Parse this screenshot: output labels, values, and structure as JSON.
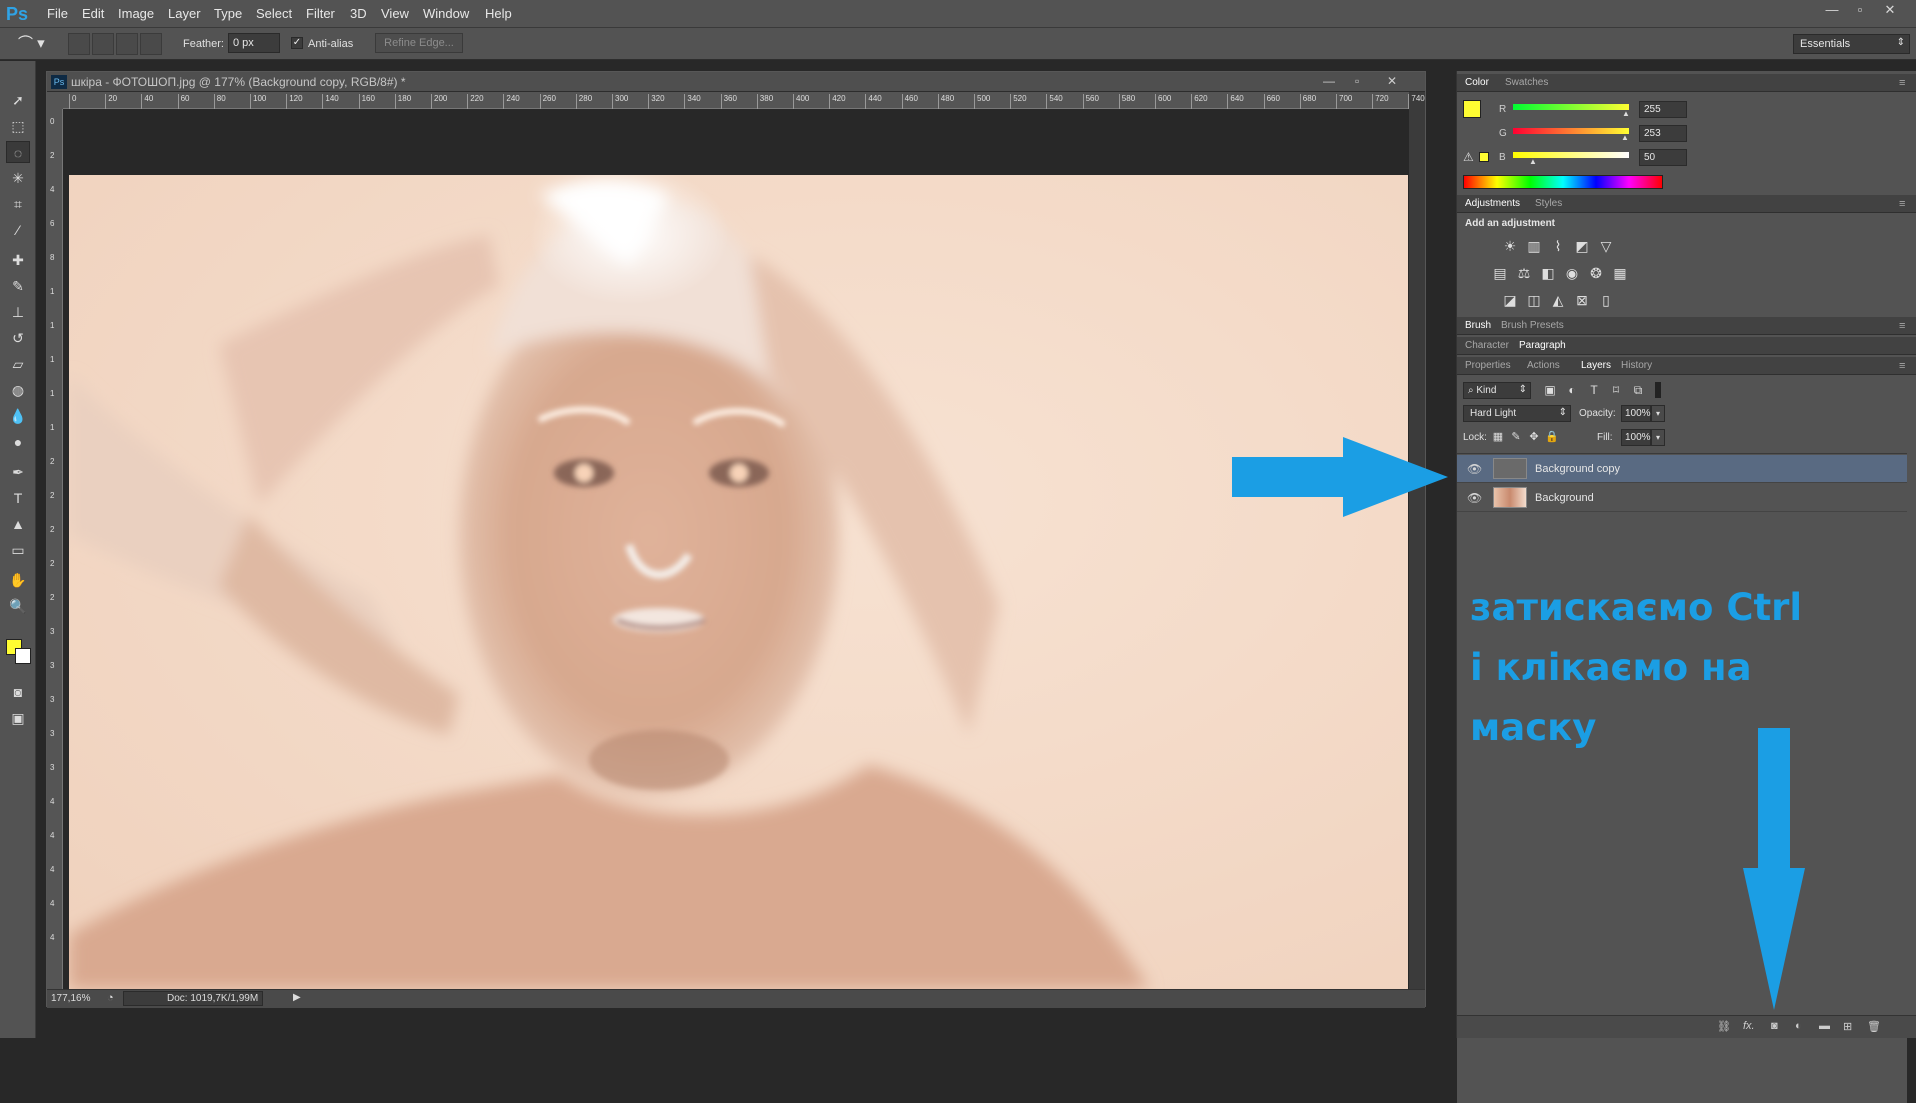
{
  "app": {
    "logo": "Ps"
  },
  "menubar": {
    "items": [
      "File",
      "Edit",
      "Image",
      "Layer",
      "Type",
      "Select",
      "Filter",
      "3D",
      "View",
      "Window",
      "Help"
    ],
    "window_buttons": [
      "—",
      "▫",
      "✕"
    ]
  },
  "options": {
    "feather_label": "Feather:",
    "feather_value": "0 px",
    "antialias_label": "Anti-alias",
    "refine_edge_label": "Refine Edge...",
    "workspace": "Essentials"
  },
  "document": {
    "title": "шкіра - ФОТОШОП.jpg @ 177% (Background copy, RGB/8#) *",
    "ruler_ticks": [
      "0",
      "20",
      "40",
      "60",
      "80",
      "100",
      "120",
      "140",
      "160",
      "180",
      "200",
      "220",
      "240",
      "260",
      "280",
      "300",
      "320",
      "340",
      "360",
      "380",
      "400",
      "420",
      "440",
      "460",
      "480",
      "500",
      "520",
      "540",
      "560",
      "580",
      "600",
      "620",
      "640",
      "660",
      "680",
      "700",
      "720",
      "740"
    ],
    "vruler_ticks": [
      "0",
      "2",
      "4",
      "6",
      "8",
      "1",
      "1",
      "1",
      "1",
      "1",
      "2",
      "2",
      "2",
      "2",
      "2",
      "3",
      "3",
      "3",
      "3",
      "3",
      "4",
      "4",
      "4",
      "4",
      "4"
    ],
    "zoom": "177,16%",
    "doc_size": "Doc: 1019,7K/1,99M"
  },
  "color_panel": {
    "tabs": [
      "Color",
      "Swatches"
    ],
    "channels": [
      {
        "label": "R",
        "value": "255"
      },
      {
        "label": "G",
        "value": "253"
      },
      {
        "label": "B",
        "value": "50"
      }
    ],
    "foreground": "#fffd32",
    "background": "#ffffff"
  },
  "adjustments_panel": {
    "tabs": [
      "Adjustments",
      "Styles"
    ],
    "heading": "Add an adjustment",
    "icons_row1": [
      "brightness-icon",
      "levels-icon",
      "curves-icon",
      "exposure-icon",
      "vibrance-icon"
    ],
    "icons_row2": [
      "hue-saturation-icon",
      "color-balance-icon",
      "black-white-icon",
      "photo-filter-icon",
      "channel-mixer-icon",
      "color-lookup-icon"
    ],
    "icons_row3": [
      "invert-icon",
      "posterize-icon",
      "threshold-icon",
      "selective-color-icon",
      "gradient-map-icon"
    ]
  },
  "brush_panel": {
    "tabs": [
      "Brush",
      "Brush Presets"
    ]
  },
  "char_panel": {
    "tabs": [
      "Character",
      "Paragraph"
    ]
  },
  "layers_panel": {
    "tabs": [
      "Properties",
      "Actions",
      "Layers",
      "History"
    ],
    "kind": "Kind",
    "blend_mode": "Hard Light",
    "opacity_label": "Opacity:",
    "opacity_value": "100%",
    "lock_label": "Lock:",
    "fill_label": "Fill:",
    "fill_value": "100%",
    "layers": [
      {
        "name": "Background copy",
        "selected": true
      },
      {
        "name": "Background",
        "selected": false
      }
    ],
    "footer_icons": [
      "link-icon",
      "fx-icon",
      "add-mask-icon",
      "adjustment-layer-icon",
      "group-folder-icon",
      "new-layer-icon",
      "trash-icon"
    ]
  },
  "annotation": {
    "lines": [
      "затискаємо Ctrl",
      "і клікаємо на",
      "маску"
    ],
    "color": "#1b9ee4"
  }
}
